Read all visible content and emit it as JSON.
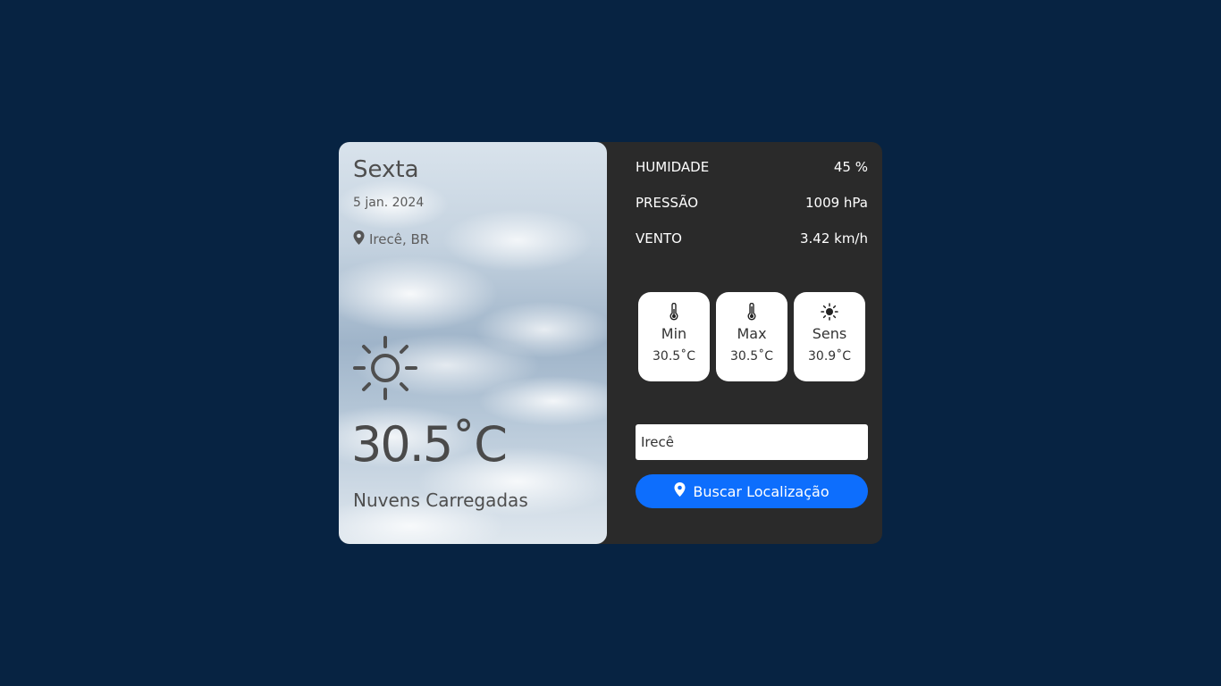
{
  "current": {
    "day": "Sexta",
    "date": "5 jan. 2024",
    "location": "Irecê, BR",
    "temperature": "30.5˚C",
    "description": "Nuvens Carregadas",
    "icon": "sun-icon"
  },
  "stats": [
    {
      "label": "HUMIDADE",
      "value": "45 %"
    },
    {
      "label": "PRESSÃO",
      "value": "1009 hPa"
    },
    {
      "label": "VENTO",
      "value": "3.42 km/h"
    }
  ],
  "cards": [
    {
      "icon": "thermometer-icon",
      "label": "Min",
      "value": "30.5˚C"
    },
    {
      "icon": "thermometer-icon",
      "label": "Max",
      "value": "30.5˚C"
    },
    {
      "icon": "sun-icon",
      "label": "Sens",
      "value": "30.9˚C"
    }
  ],
  "search": {
    "value": "Irecê",
    "button_label": "Buscar Localização",
    "button_icon": "location-pin-icon"
  },
  "colors": {
    "page_background": "#072342",
    "panel_background": "#2a2a2a",
    "accent": "#0d6efd",
    "card_background": "#ffffff"
  }
}
